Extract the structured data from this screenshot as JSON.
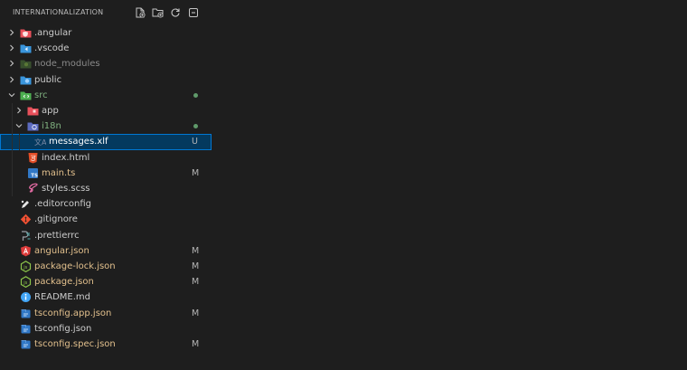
{
  "header": {
    "title": "INTERNATIONALIZATION",
    "buttons": [
      "new-file-icon",
      "new-folder-icon",
      "refresh-icon",
      "collapse-all-icon"
    ]
  },
  "colors": {
    "background": "#1e1e1e",
    "selected": "#04395e",
    "focus_border": "#0078d4",
    "modified_badge": "#b5b5b5",
    "git_dot": "#5f9a6a"
  },
  "tree": [
    {
      "label": ".angular",
      "depth": 0,
      "type": "folder",
      "expanded": false,
      "icon": "angular-folder-icon",
      "badge": "",
      "dot": false,
      "dim": false
    },
    {
      "label": ".vscode",
      "depth": 0,
      "type": "folder",
      "expanded": false,
      "icon": "vscode-folder-icon",
      "badge": "",
      "dot": false,
      "dim": false
    },
    {
      "label": "node_modules",
      "depth": 0,
      "type": "folder",
      "expanded": false,
      "icon": "node-folder-icon",
      "badge": "",
      "dot": false,
      "dim": true
    },
    {
      "label": "public",
      "depth": 0,
      "type": "folder",
      "expanded": false,
      "icon": "public-folder-icon",
      "badge": "",
      "dot": false,
      "dim": false
    },
    {
      "label": "src",
      "depth": 0,
      "type": "folder",
      "expanded": true,
      "icon": "src-folder-icon",
      "badge": "",
      "dot": true,
      "dim": false
    },
    {
      "label": "app",
      "depth": 1,
      "type": "folder",
      "expanded": false,
      "icon": "app-folder-icon",
      "badge": "",
      "dot": false,
      "dim": false
    },
    {
      "label": "i18n",
      "depth": 1,
      "type": "folder",
      "expanded": true,
      "icon": "i18n-folder-icon",
      "badge": "",
      "dot": true,
      "dim": false
    },
    {
      "label": "messages.xlf",
      "depth": 2,
      "type": "file",
      "icon": "translate-file-icon",
      "badge": "U",
      "dot": false,
      "selected": true,
      "dim": false
    },
    {
      "label": "index.html",
      "depth": 1,
      "type": "file",
      "icon": "html-file-icon",
      "badge": "",
      "dot": false,
      "dim": false
    },
    {
      "label": "main.ts",
      "depth": 1,
      "type": "file",
      "icon": "typescript-file-icon",
      "badge": "M",
      "dot": false,
      "dim": false
    },
    {
      "label": "styles.scss",
      "depth": 1,
      "type": "file",
      "icon": "sass-file-icon",
      "badge": "",
      "dot": false,
      "dim": false
    },
    {
      "label": ".editorconfig",
      "depth": 0,
      "type": "file",
      "icon": "editorconfig-file-icon",
      "badge": "",
      "dot": false,
      "dim": false
    },
    {
      "label": ".gitignore",
      "depth": 0,
      "type": "file",
      "icon": "git-file-icon",
      "badge": "",
      "dot": false,
      "dim": false
    },
    {
      "label": ".prettierrc",
      "depth": 0,
      "type": "file",
      "icon": "prettier-file-icon",
      "badge": "",
      "dot": false,
      "dim": false
    },
    {
      "label": "angular.json",
      "depth": 0,
      "type": "file",
      "icon": "angular-file-icon",
      "badge": "M",
      "dot": false,
      "dim": false
    },
    {
      "label": "package-lock.json",
      "depth": 0,
      "type": "file",
      "icon": "node-file-icon",
      "badge": "M",
      "dot": false,
      "dim": false
    },
    {
      "label": "package.json",
      "depth": 0,
      "type": "file",
      "icon": "node-file-icon",
      "badge": "M",
      "dot": false,
      "dim": false
    },
    {
      "label": "README.md",
      "depth": 0,
      "type": "file",
      "icon": "info-file-icon",
      "badge": "",
      "dot": false,
      "dim": false
    },
    {
      "label": "tsconfig.app.json",
      "depth": 0,
      "type": "file",
      "icon": "tsconfig-file-icon",
      "badge": "M",
      "dot": false,
      "dim": false
    },
    {
      "label": "tsconfig.json",
      "depth": 0,
      "type": "file",
      "icon": "tsconfig-file-icon",
      "badge": "",
      "dot": false,
      "dim": false
    },
    {
      "label": "tsconfig.spec.json",
      "depth": 0,
      "type": "file",
      "icon": "tsconfig-file-icon",
      "badge": "M",
      "dot": false,
      "dim": false
    }
  ]
}
